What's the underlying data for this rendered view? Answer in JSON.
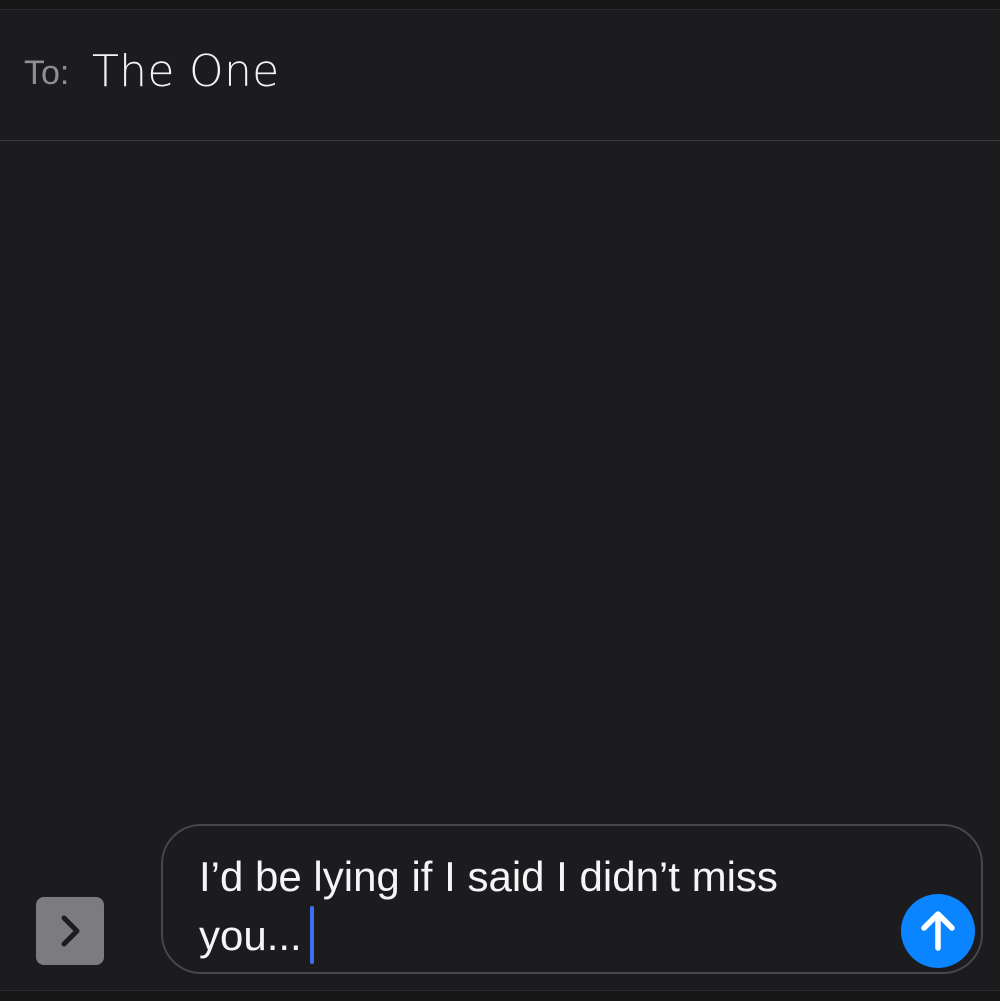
{
  "header": {
    "to_label": "To:",
    "recipient": "The One"
  },
  "compose": {
    "text": "I’d be lying if I said I didn’t miss you..."
  },
  "icons": {
    "expand": "chevron-right-icon",
    "send": "arrow-up-icon"
  },
  "colors": {
    "background": "#1c1c1e",
    "send_button": "#0a84ff",
    "caret": "#3e6ef5",
    "expand_button": "#7c7c80"
  }
}
